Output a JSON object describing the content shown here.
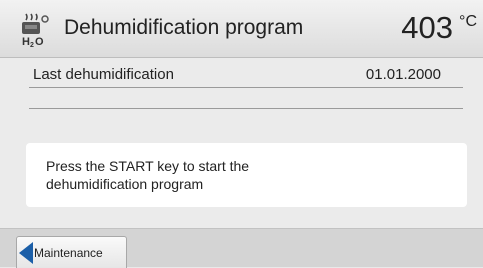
{
  "header": {
    "icon": "dehumidification-icon",
    "title": "Dehumidification program",
    "temperature": "403",
    "unit": "°C"
  },
  "info": {
    "last_dehumidification_label": "Last dehumidification",
    "last_dehumidification_value": "01.01.2000"
  },
  "message": {
    "text": "Press the START key to start the dehumidification program"
  },
  "footer": {
    "back_icon": "arrow-left-icon",
    "back_label": "Maintenance",
    "accent_color": "#1c5fa8"
  }
}
